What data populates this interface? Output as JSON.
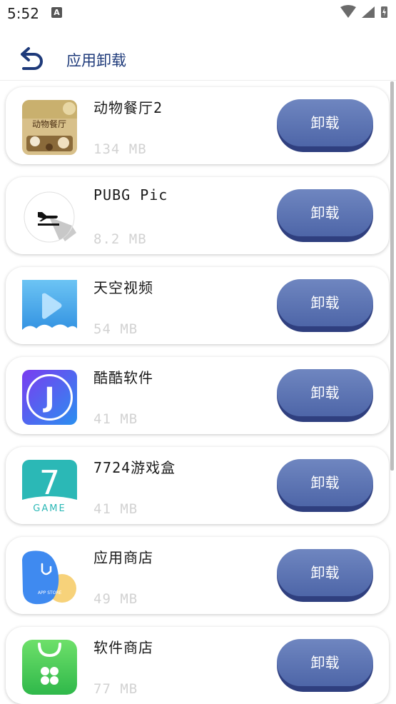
{
  "status_bar": {
    "time": "5:52",
    "a_badge": "A"
  },
  "header": {
    "title": "应用卸载",
    "back_icon": "back-arrow-icon"
  },
  "accent_color": "#1e3a7a",
  "button_color": "#5c72b2",
  "apps": [
    {
      "name": "动物餐厅2",
      "size": "134 MB",
      "action": "卸载",
      "icon": "animal-restaurant-icon",
      "icon_text": "动物餐厅"
    },
    {
      "name": "PUBG Pic",
      "size": "8.2 MB",
      "action": "卸载",
      "icon": "airplane-departure-icon"
    },
    {
      "name": "天空视频",
      "size": "54 MB",
      "action": "卸载",
      "icon": "play-cloud-icon"
    },
    {
      "name": "酷酷软件",
      "size": "41 MB",
      "action": "卸载",
      "icon": "letter-j-icon",
      "icon_text": "J"
    },
    {
      "name": "7724游戏盒",
      "size": "41 MB",
      "action": "卸载",
      "icon": "game-7-icon",
      "icon_text": "7",
      "icon_subtext": "GAME"
    },
    {
      "name": "应用商店",
      "size": "49 MB",
      "action": "卸载",
      "icon": "app-store-icon",
      "icon_text": "APP STORE"
    },
    {
      "name": "软件商店",
      "size": "77 MB",
      "action": "卸载",
      "icon": "software-store-icon"
    }
  ]
}
